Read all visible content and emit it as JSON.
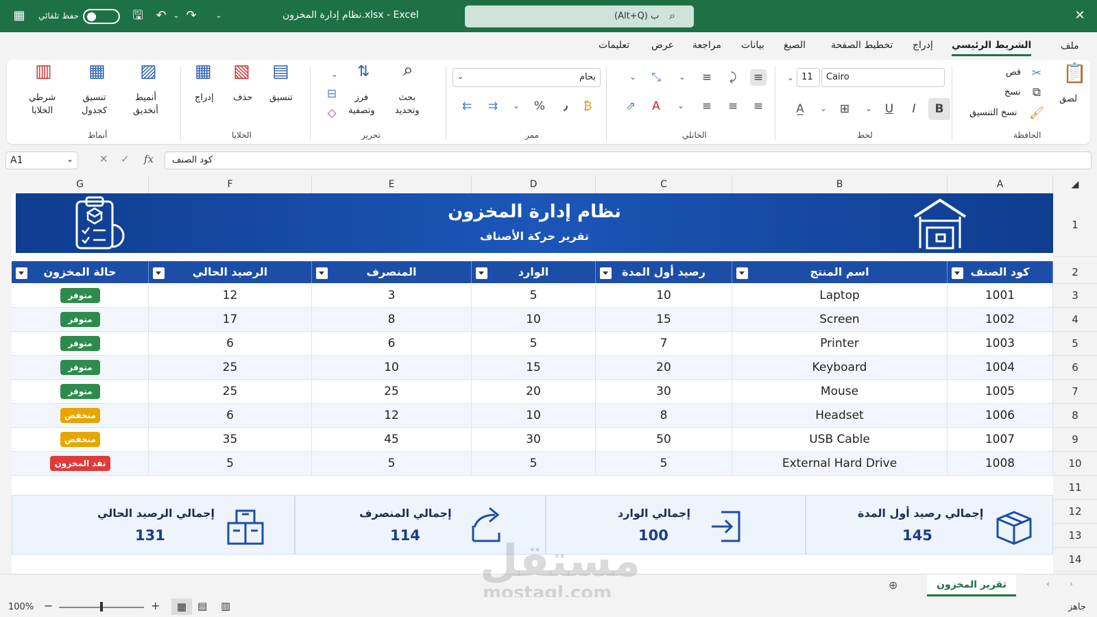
{
  "window": {
    "title": "نظام إدارة المخزون.xlsx - Excel",
    "autosave_label": "حفظ تلقائي",
    "search_placeholder": "(Alt+Q) ب",
    "close": "✕"
  },
  "tabs": [
    "ملف",
    "الشريط الرئيسي",
    "إدراج",
    "تخطيط الصفحة",
    "الصيغ",
    "بيانات",
    "مراجعة",
    "عرض",
    "تعليمات"
  ],
  "ribbon": {
    "clipboard": {
      "group": "الحافظة",
      "paste": "لصق",
      "cut": "قص",
      "copy": "نسخ",
      "format_painter": "نسخ التنسيق"
    },
    "font": {
      "group": "لخط",
      "name": "Cairo",
      "size": "11",
      "bold": "B",
      "italic": "I",
      "underline": "U"
    },
    "alignment": {
      "group": "الخانلي"
    },
    "number": {
      "group": "ممر",
      "format": "بحام",
      "percent": "%",
      "comma": "٫"
    },
    "editing": {
      "group": "تحرير",
      "find": "بحث\nوتحديد",
      "sort": "فرز\nوتصفية"
    },
    "cells": {
      "group": "الخلايا",
      "format": "تنسيق",
      "delete": "حذف",
      "insert": "إدراج"
    },
    "styles": {
      "group": "أنماط",
      "cell_styles": "أنميط\nأنخديق",
      "format_table": "تنسيق\nكجدول",
      "conditional": "شرطي\nالخلايا"
    }
  },
  "formula_bar": {
    "name_box": "A1",
    "fx": "fx",
    "content": "كود الصنف"
  },
  "columns": [
    "A",
    "B",
    "C",
    "D",
    "E",
    "F",
    "G"
  ],
  "rows": [
    "1",
    "2",
    "3",
    "4",
    "5",
    "6",
    "7",
    "8",
    "9",
    "10",
    "11",
    "12",
    "13",
    "14"
  ],
  "banner": {
    "title": "نظام إدارة المخزون",
    "subtitle": "تقرير حركة الأصناف"
  },
  "table": {
    "headers": [
      "كود الصنف",
      "اسم المنتج",
      "رصيد أول المدة",
      "الوارد",
      "المنصرف",
      "الرصيد الحالي",
      "حالة المخزون"
    ],
    "rows": [
      [
        "1001",
        "Laptop",
        "10",
        "5",
        "3",
        "12",
        "متوفر"
      ],
      [
        "1002",
        "Screen",
        "15",
        "10",
        "8",
        "17",
        "متوفر"
      ],
      [
        "1003",
        "Printer",
        "7",
        "5",
        "6",
        "6",
        "متوفر"
      ],
      [
        "1004",
        "Keyboard",
        "20",
        "15",
        "10",
        "25",
        "متوفر"
      ],
      [
        "1005",
        "Mouse",
        "30",
        "20",
        "25",
        "25",
        "متوفر"
      ],
      [
        "1006",
        "Headset",
        "8",
        "10",
        "12",
        "6",
        "منخفض"
      ],
      [
        "1007",
        "USB Cable",
        "50",
        "30",
        "45",
        "35",
        "منخفض"
      ],
      [
        "1008",
        "External Hard Drive",
        "5",
        "5",
        "5",
        "5",
        "نفد المخزون"
      ]
    ],
    "status_colors": {
      "متوفر": "#2e8b4e",
      "منخفض": "#e8a500",
      "نفد المخزون": "#e03a3a"
    }
  },
  "summary": [
    {
      "label": "إجمالي رصيد أول المدة",
      "value": "145",
      "icon": "box-icon"
    },
    {
      "label": "إجمالي الوارد",
      "value": "100",
      "icon": "login-arrow-icon"
    },
    {
      "label": "إجمالي المنصرف",
      "value": "114",
      "icon": "share-arrow-icon"
    },
    {
      "label": "إجمالي الرصيد الحالي",
      "value": "131",
      "icon": "stacked-boxes-icon"
    }
  ],
  "sheet_tab": "تقرير المخزون",
  "status": {
    "ready": "جاهز",
    "zoom": "100%"
  },
  "watermark": {
    "text": "مستقل",
    "domain": "mostaql.com"
  },
  "colors": {
    "excel_green": "#1e7145",
    "banner_blue": "#1b56b8",
    "header_blue": "#1d4ea7"
  }
}
